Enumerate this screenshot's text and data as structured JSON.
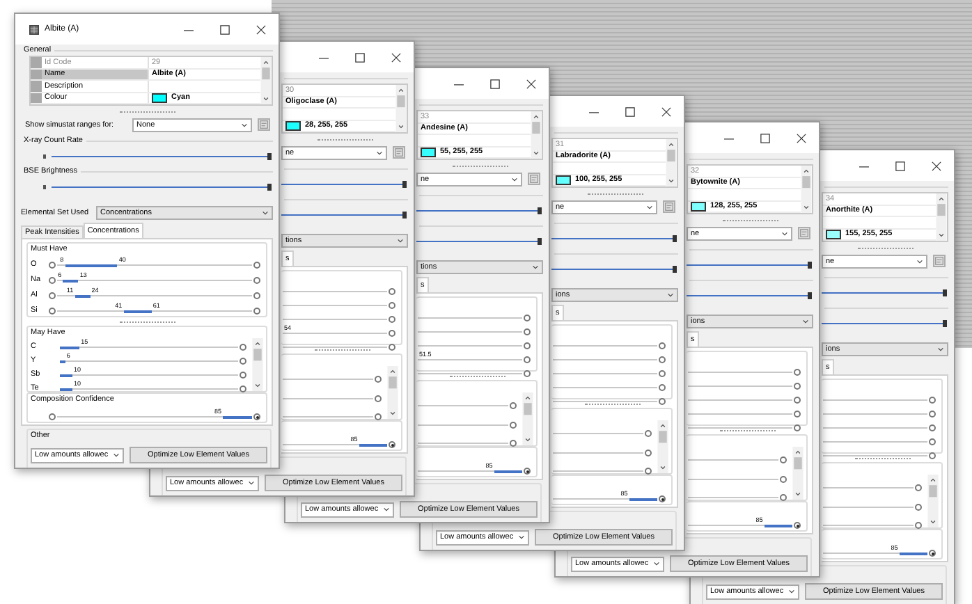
{
  "windows": [
    {
      "kind": "full",
      "title": "Albite (A)",
      "general": {
        "label": "General",
        "rows": [
          {
            "label": "Id Code",
            "value": "29",
            "disabled": true,
            "selected": false
          },
          {
            "label": "Name",
            "value": "Albite (A)",
            "disabled": false,
            "modified": true,
            "selected": true
          },
          {
            "label": "Description",
            "selected": false
          },
          {
            "label": "Colour",
            "value": "Cyan",
            "color": "#00ffff",
            "disabled": false,
            "modified": true,
            "selected": false
          }
        ]
      },
      "simustat": {
        "label": "Show simustat ranges for:",
        "value": "None"
      },
      "xray": {
        "label": "X-ray Count Rate",
        "level": 1
      },
      "bse": {
        "label": "BSE Brightness",
        "level": 1
      },
      "elemental": {
        "label": "Elemental Set Used",
        "value": "Concentrations"
      },
      "tabs": [
        {
          "label": "Peak Intensities",
          "selected": false
        },
        {
          "label": "Concentrations",
          "selected": true
        }
      ],
      "must_have": {
        "label": "Must Have",
        "rows": [
          {
            "element": "O",
            "min": {
              "label": "8",
              "level": 0.04
            },
            "max": {
              "label": "40",
              "level": 0.31
            },
            "radios": [
              {
                "checked": false
              },
              {
                "checked": false
              }
            ]
          },
          {
            "element": "Na",
            "min": {
              "label": "6",
              "level": 0.03
            },
            "max": {
              "label": "13",
              "level": 0.11
            },
            "radios": [
              {
                "checked": false
              },
              {
                "checked": false
              }
            ]
          },
          {
            "element": "Al",
            "min": {
              "label": "11",
              "level": 0.09
            },
            "max": {
              "label": "24",
              "level": 0.17
            },
            "radios": [
              {
                "checked": false
              },
              {
                "checked": false
              }
            ]
          },
          {
            "element": "Si",
            "min": {
              "label": "41"
            },
            "max": {
              "label": "61"
            },
            "radios": [
              {
                "checked": false
              },
              {
                "checked": false
              }
            ]
          }
        ]
      },
      "may_have": {
        "label": "May Have",
        "rows": [
          {
            "element": "C",
            "max": {
              "label": "15",
              "level": 0.11
            },
            "radios": [
              {
                "checked": false
              }
            ]
          },
          {
            "element": "Y",
            "max": {
              "label": "6",
              "level": 0.03
            },
            "radios": [
              {
                "checked": false
              }
            ]
          },
          {
            "element": "Sb",
            "max": {
              "label": "10",
              "level": 0.07
            },
            "radios": [
              {
                "checked": false
              }
            ]
          },
          {
            "element": "Te",
            "max": {
              "label": "10",
              "level": 0.07
            },
            "radios": [
              {
                "checked": false
              }
            ]
          }
        ]
      },
      "composition": {
        "label": "Composition Confidence",
        "rows": [
          {
            "min": {
              "label": "85"
            },
            "radios": [
              {
                "checked": false
              },
              {
                "checked": true
              }
            ]
          }
        ]
      },
      "other": {
        "label": "Other",
        "mode": "Low amounts allowec",
        "button": "Optimize Low Element Values"
      }
    },
    {
      "kind": "partial",
      "general": {
        "rows": [
          {
            "value": "30",
            "disabled": true
          },
          {
            "value": "Oligoclase (A)",
            "disabled": false,
            "modified": true
          },
          {
            "value": "28, 255, 255",
            "color": "#1cffff",
            "disabled": false,
            "modified": true
          }
        ]
      },
      "simustat": {
        "value": "ne"
      },
      "xray": {
        "level": 1
      },
      "bse": {
        "level": 1
      },
      "elemental": {
        "value": "tions"
      },
      "tabs": [
        {
          "label": "s",
          "selected": true
        }
      ],
      "must_have": {
        "rows": [
          {
            "radios": [
              {
                "checked": false
              }
            ]
          },
          {
            "radios": [
              {
                "checked": false
              }
            ]
          },
          {
            "radios": [
              {
                "checked": false
              }
            ]
          },
          {
            "max": {
              "label": "54"
            },
            "radios": [
              {
                "checked": false
              }
            ]
          },
          {
            "radios": [
              {
                "checked": false
              }
            ]
          }
        ]
      },
      "may_have": {
        "rows": [
          {
            "radios": [
              {
                "checked": false
              }
            ]
          },
          {
            "radios": [
              {
                "checked": false
              }
            ]
          },
          {
            "radios": [
              {
                "checked": false
              }
            ]
          }
        ]
      },
      "composition": {
        "rows": [
          {
            "min": {
              "label": "85"
            },
            "radios": [
              {
                "checked": true
              }
            ]
          }
        ]
      },
      "other": {
        "mode": "Low amounts allowec",
        "button": "Optimize Low Element Values"
      }
    },
    {
      "kind": "partial",
      "general": {
        "rows": [
          {
            "value": "33",
            "disabled": true
          },
          {
            "value": "Andesine (A)",
            "disabled": false,
            "modified": true
          },
          {
            "value": "55, 255, 255",
            "color": "#37ffff",
            "disabled": false,
            "modified": true
          }
        ]
      },
      "simustat": {
        "value": "ne"
      },
      "xray": {
        "level": 1
      },
      "bse": {
        "level": 1
      },
      "elemental": {
        "value": "tions"
      },
      "tabs": [
        {
          "label": "s",
          "selected": true
        }
      ],
      "must_have": {
        "rows": [
          {
            "radios": [
              {
                "checked": false
              }
            ]
          },
          {
            "radios": [
              {
                "checked": false
              }
            ]
          },
          {
            "radios": [
              {
                "checked": false
              }
            ]
          },
          {
            "max": {
              "label": "51.5"
            },
            "radios": [
              {
                "checked": false
              }
            ]
          },
          {
            "radios": [
              {
                "checked": false
              }
            ]
          }
        ]
      },
      "may_have": {
        "rows": [
          {
            "radios": [
              {
                "checked": false
              }
            ]
          },
          {
            "radios": [
              {
                "checked": false
              }
            ]
          },
          {
            "radios": [
              {
                "checked": false
              }
            ]
          }
        ]
      },
      "composition": {
        "rows": [
          {
            "min": {
              "label": "85"
            },
            "radios": [
              {
                "checked": true
              }
            ]
          }
        ]
      },
      "other": {
        "mode": "Low amounts allowec",
        "button": "Optimize Low Element Values"
      }
    },
    {
      "kind": "partial",
      "general": {
        "rows": [
          {
            "value": "31",
            "disabled": true
          },
          {
            "value": "Labradorite (A)",
            "disabled": false,
            "modified": true
          },
          {
            "value": "100, 255, 255",
            "color": "#64ffff",
            "disabled": false,
            "modified": true
          }
        ]
      },
      "simustat": {
        "value": "ne"
      },
      "xray": {
        "level": 1
      },
      "bse": {
        "level": 1
      },
      "elemental": {
        "value": "ions"
      },
      "tabs": [
        {
          "label": "s",
          "selected": true
        }
      ],
      "must_have": {
        "rows": [
          {
            "radios": [
              {
                "checked": false
              }
            ]
          },
          {
            "radios": [
              {
                "checked": false
              }
            ]
          },
          {
            "radios": [
              {
                "checked": false
              }
            ]
          },
          {
            "radios": [
              {
                "checked": false
              }
            ]
          },
          {
            "radios": [
              {
                "checked": false
              }
            ]
          }
        ]
      },
      "may_have": {
        "rows": [
          {
            "radios": [
              {
                "checked": false
              }
            ]
          },
          {
            "radios": [
              {
                "checked": false
              }
            ]
          },
          {
            "radios": [
              {
                "checked": false
              }
            ]
          }
        ]
      },
      "composition": {
        "rows": [
          {
            "min": {
              "label": "85"
            },
            "radios": [
              {
                "checked": true
              }
            ]
          }
        ]
      },
      "other": {
        "mode": "Low amounts allowec",
        "button": "Optimize Low Element Values"
      }
    },
    {
      "kind": "partial",
      "general": {
        "rows": [
          {
            "value": "32",
            "disabled": true
          },
          {
            "value": "Bytownite (A)",
            "disabled": false,
            "modified": true
          },
          {
            "value": "128, 255, 255",
            "color": "#80ffff",
            "disabled": false,
            "modified": true
          }
        ]
      },
      "simustat": {
        "value": "ne"
      },
      "xray": {
        "level": 1
      },
      "bse": {
        "level": 1
      },
      "elemental": {
        "value": "ions"
      },
      "tabs": [
        {
          "label": "s",
          "selected": true
        }
      ],
      "must_have": {
        "rows": [
          {
            "radios": [
              {
                "checked": false
              }
            ]
          },
          {
            "radios": [
              {
                "checked": false
              }
            ]
          },
          {
            "radios": [
              {
                "checked": false
              }
            ]
          },
          {
            "radios": [
              {
                "checked": false
              }
            ]
          },
          {
            "radios": [
              {
                "checked": false
              }
            ]
          }
        ]
      },
      "may_have": {
        "rows": [
          {
            "radios": [
              {
                "checked": false
              }
            ]
          },
          {
            "radios": [
              {
                "checked": false
              }
            ]
          },
          {
            "radios": [
              {
                "checked": false
              }
            ]
          }
        ]
      },
      "composition": {
        "rows": [
          {
            "min": {
              "label": "85"
            },
            "radios": [
              {
                "checked": true
              }
            ]
          }
        ]
      },
      "other": {
        "mode": "Low amounts allowec",
        "button": "Optimize Low Element Values"
      }
    },
    {
      "kind": "partial",
      "general": {
        "rows": [
          {
            "value": "34",
            "disabled": true
          },
          {
            "value": "Anorthite (A)",
            "disabled": false,
            "modified": true
          },
          {
            "value": "155, 255, 255",
            "color": "#9bffff",
            "disabled": false,
            "modified": true
          }
        ]
      },
      "simustat": {
        "value": "ne"
      },
      "xray": {
        "level": 1
      },
      "bse": {
        "level": 1
      },
      "elemental": {
        "value": "ions"
      },
      "tabs": [
        {
          "label": "s",
          "selected": true
        }
      ],
      "must_have": {
        "rows": [
          {
            "radios": [
              {
                "checked": false
              }
            ]
          },
          {
            "radios": [
              {
                "checked": false
              }
            ]
          },
          {
            "radios": [
              {
                "checked": false
              }
            ]
          },
          {
            "radios": [
              {
                "checked": false
              }
            ]
          },
          {
            "radios": [
              {
                "checked": false
              }
            ]
          }
        ]
      },
      "may_have": {
        "rows": [
          {
            "radios": [
              {
                "checked": false
              }
            ]
          },
          {
            "radios": [
              {
                "checked": false
              }
            ]
          },
          {
            "radios": [
              {
                "checked": false
              }
            ]
          }
        ]
      },
      "composition": {
        "rows": [
          {
            "min": {
              "label": "85"
            },
            "radios": [
              {
                "checked": true
              }
            ]
          }
        ]
      },
      "other": {
        "mode": "Low amounts allowec",
        "button": "Optimize Low Element Values"
      }
    }
  ]
}
